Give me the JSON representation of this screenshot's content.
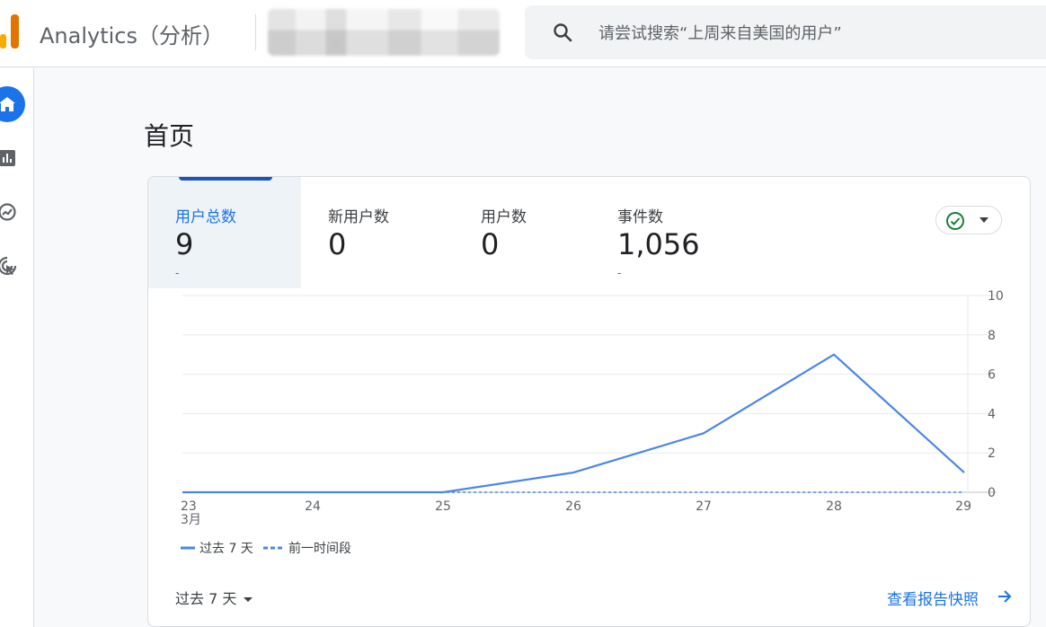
{
  "header": {
    "app_title": "Analytics（分析）",
    "search_placeholder": "请尝试搜索“上周来自美国的用户”"
  },
  "nav": {
    "items": [
      "home-icon",
      "reports-icon",
      "explore-icon",
      "advertising-icon"
    ],
    "active": "home-icon"
  },
  "page": {
    "title": "首页"
  },
  "metrics": [
    {
      "label": "用户总数",
      "value": "9",
      "delta": "-"
    },
    {
      "label": "新用户数",
      "value": "0",
      "delta": ""
    },
    {
      "label": "用户数",
      "value": "0",
      "delta": ""
    },
    {
      "label": "事件数",
      "value": "1,056",
      "delta": "-"
    }
  ],
  "colors": {
    "accent": "#1a73e8",
    "line": "#4a86e8",
    "status_ok": "#188038"
  },
  "chart_data": {
    "type": "line",
    "x": [
      "23",
      "24",
      "25",
      "26",
      "27",
      "28",
      "29"
    ],
    "x_sublabel_first": "3月",
    "series": [
      {
        "name": "过去 7 天",
        "values": [
          0,
          0,
          0,
          1,
          3,
          7,
          1
        ],
        "style": "solid"
      },
      {
        "name": "前一时间段",
        "values": [
          0,
          0,
          0,
          0,
          0,
          0,
          0
        ],
        "style": "dashed"
      }
    ],
    "ylim": [
      0,
      10
    ],
    "yticks": [
      0,
      2,
      4,
      6,
      8,
      10
    ],
    "grid": true,
    "y_axis_side": "right",
    "legend_placement": "bottom-left"
  },
  "footer": {
    "range_label": "过去 7 天",
    "snapshot_link": "查看报告快照"
  }
}
